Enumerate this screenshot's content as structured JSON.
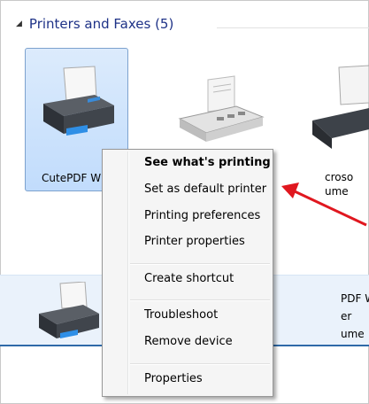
{
  "group": {
    "title": "Printers and Faxes (5)"
  },
  "devices": {
    "cutepdf_label": "CutePDF W",
    "ms_label_line1": "croso",
    "ms_label_line2": "ume",
    "lower_label_line1": "PDF W",
    "lower_label_line2": "er",
    "lower_label_line3": "ume"
  },
  "context_menu": {
    "items": [
      {
        "label": "See what's printing",
        "bold": true
      },
      {
        "label": "Set as default printer"
      },
      {
        "label": "Printing preferences"
      },
      {
        "label": "Printer properties"
      },
      {
        "label": "Create shortcut"
      },
      {
        "label": "Troubleshoot"
      },
      {
        "label": "Remove device"
      },
      {
        "label": "Properties"
      }
    ]
  },
  "colors": {
    "arrow": "#e0171f",
    "selection": "#c1dcfc",
    "header_text": "#1e3287"
  }
}
